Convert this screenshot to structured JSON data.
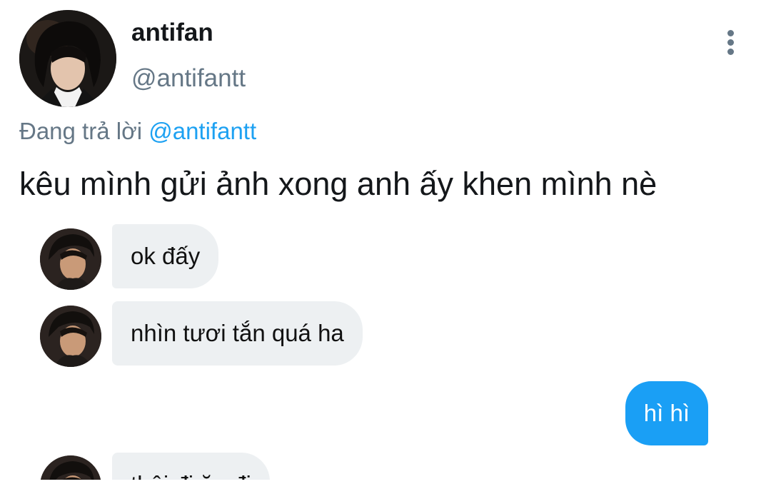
{
  "tweet": {
    "display_name": "antifan",
    "handle": "@antifantt",
    "reply_prefix": "Đang trả lời",
    "reply_mention": "@antifantt",
    "text": "kêu mình gửi ảnh xong anh ấy khen mình nè"
  },
  "chat": {
    "messages": [
      {
        "sender": "other",
        "text": "ok đấy"
      },
      {
        "sender": "other",
        "text": "nhìn tươi tắn quá ha"
      },
      {
        "sender": "me",
        "text": "hì hì"
      },
      {
        "sender": "other",
        "text": "thôi đi ăn đi"
      }
    ]
  },
  "colors": {
    "accent": "#1da1f2",
    "secondary_text": "#657786",
    "bubble_other": "#edf0f2",
    "bubble_me": "#1a9ff5"
  },
  "icons": {
    "more": "more-vertical-icon"
  }
}
